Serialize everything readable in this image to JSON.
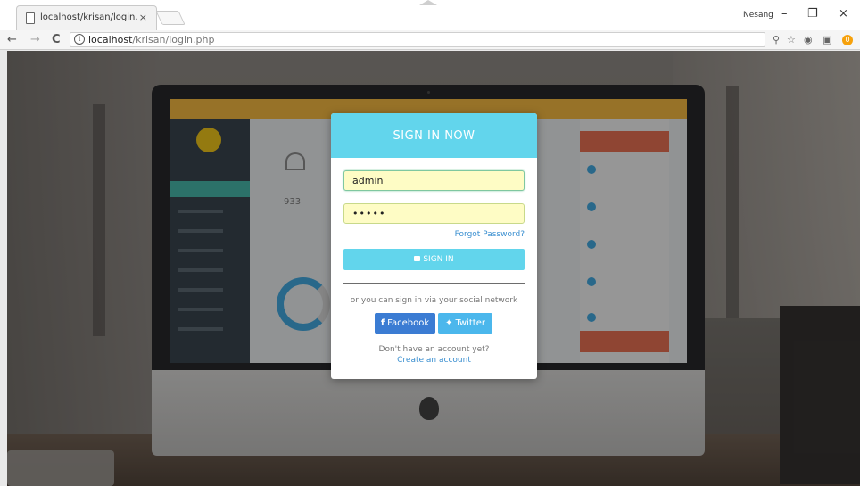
{
  "browser": {
    "tab_title": "localhost/krisan/login.php",
    "tab_close": "×",
    "profile_name": "Nesang",
    "window_minimize": "–",
    "window_restore": "❐",
    "window_close": "×",
    "back": "←",
    "forward": "→",
    "reload": "C",
    "info_glyph": "i",
    "url_host": "localhost",
    "url_path": "/krisan/login.php",
    "ext_badge_count": "0"
  },
  "login": {
    "heading": "SIGN IN NOW",
    "username_value": "admin",
    "password_value": "•••••",
    "forgot_password": "Forgot Password?",
    "signin_label": "SIGN IN",
    "social_prompt": "or you can sign in via your social network",
    "facebook_label": "Facebook",
    "twitter_label": "Twitter",
    "no_account": "Don't have an account yet?",
    "create_account": "Create an account"
  },
  "background_screen": {
    "stat_number": "933"
  },
  "colors": {
    "accent": "#62d5ec",
    "facebook": "#3b7cd3",
    "twitter": "#4bb7ec",
    "input_bg": "#fefcc5",
    "link": "#3a8fd0"
  }
}
